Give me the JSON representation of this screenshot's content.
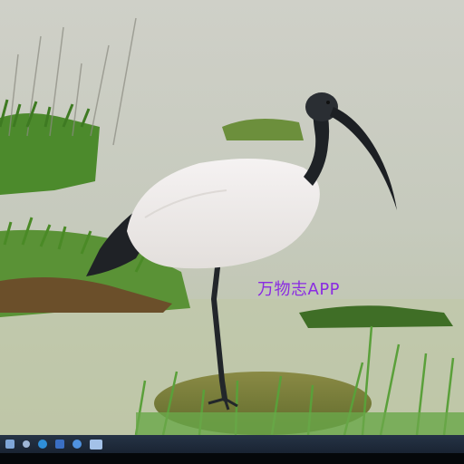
{
  "watermark": {
    "text": "万物志APP",
    "color": "#8a2be2"
  },
  "taskbar": {
    "icons": [
      "windows-start-icon",
      "search-icon",
      "edge-browser-icon",
      "store-icon",
      "chrome-icon",
      "app-window-icon"
    ]
  },
  "scene": {
    "background_water": "#c5c9bd",
    "grass": "#4f8a2e",
    "bird_body": "#f1eeee",
    "bird_head_neck": "#1e2226"
  }
}
